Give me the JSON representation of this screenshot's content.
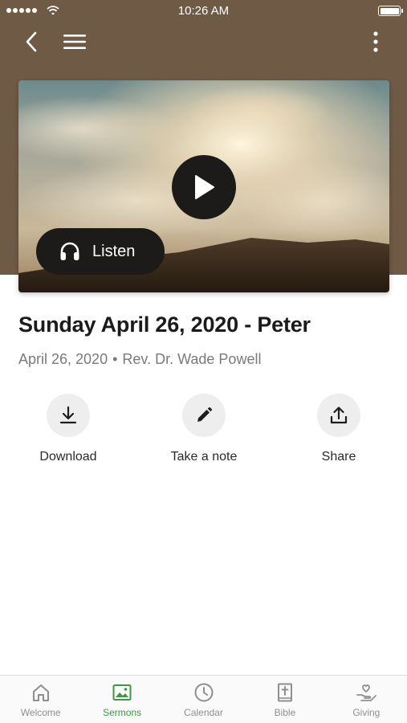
{
  "status_bar": {
    "time": "10:26 AM"
  },
  "header": {
    "back_icon": "chevron-left-icon",
    "menu_icon": "hamburger-icon",
    "more_icon": "vertical-ellipsis-icon"
  },
  "media": {
    "listen_label": "Listen",
    "play_icon": "play-icon",
    "listen_icon": "headphones-icon"
  },
  "sermon": {
    "title": "Sunday April 26, 2020 - Peter",
    "date": "April 26, 2020",
    "separator": "•",
    "speaker": "Rev. Dr. Wade Powell"
  },
  "actions": [
    {
      "label": "Download",
      "icon": "download-icon"
    },
    {
      "label": "Take a note",
      "icon": "pencil-icon"
    },
    {
      "label": "Share",
      "icon": "share-icon"
    }
  ],
  "tabs": [
    {
      "label": "Welcome",
      "icon": "home-icon",
      "active": false
    },
    {
      "label": "Sermons",
      "icon": "image-icon",
      "active": true
    },
    {
      "label": "Calendar",
      "icon": "clock-icon",
      "active": false
    },
    {
      "label": "Bible",
      "icon": "bible-icon",
      "active": false
    },
    {
      "label": "Giving",
      "icon": "giving-hand-icon",
      "active": false
    }
  ],
  "colors": {
    "header_brown": "#6f5a45",
    "active_tab_green": "#3a9a3f",
    "dark_button": "#1d1b19",
    "action_circle_bg": "#eeeeef"
  }
}
